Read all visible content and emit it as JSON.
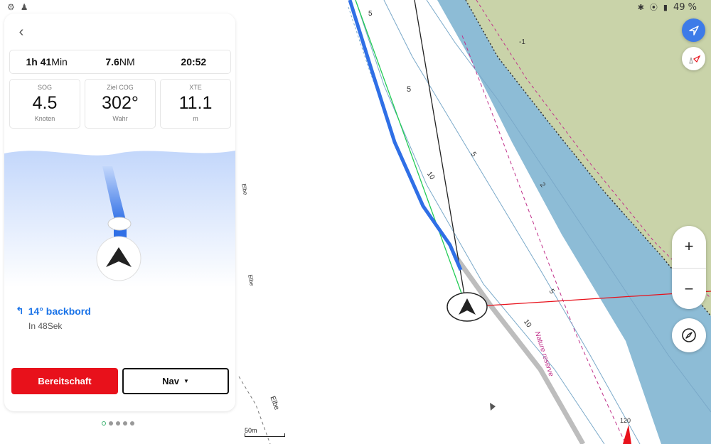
{
  "status_bar": {
    "left_icons": [
      "gear-icon",
      "pawn-icon"
    ],
    "right_icons": [
      "bluetooth-icon",
      "location-pin-icon",
      "battery-icon"
    ],
    "battery": "49 %"
  },
  "panel": {
    "summary": {
      "duration_hours": "1h",
      "duration_minutes": "41",
      "duration_minutes_unit": "Min",
      "distance_value": "7.6",
      "distance_unit": "NM",
      "eta": "20:52"
    },
    "metrics": [
      {
        "label": "SOG",
        "value": "4.5",
        "unit": "Knoten"
      },
      {
        "label": "Ziel COG",
        "value": "302°",
        "unit": "Wahr"
      },
      {
        "label": "XTE",
        "value": "11.1",
        "unit": "m"
      }
    ],
    "instruction": {
      "text": "14° backbord",
      "subtext": "In 48Sek"
    },
    "buttons": {
      "standby": "Bereitschaft",
      "nav": "Nav"
    },
    "pager": {
      "count": 5,
      "active": 0
    }
  },
  "map": {
    "scale_label": "50m",
    "labels": {
      "elbe_1": "Elbe",
      "elbe_2": "Elbe",
      "elbe_3": "Elbe",
      "nature_reserve": "Nature reserve",
      "depth_5a": "5",
      "depth_5b": "5",
      "depth_10a": "10",
      "depth_10b": "10",
      "depth_5c": "5",
      "depth_5d": "5",
      "depth_neg1": "-1",
      "depth_2": "2",
      "bearing_120": "120"
    }
  },
  "colors": {
    "water_deep": "#8dbcd6",
    "land": "#c9d3a9",
    "route_blue": "#2f6fe6",
    "course_green": "#22cc55",
    "red_line": "#e8111b",
    "accent_blue": "#3d7be8",
    "magenta_label": "#c0308a"
  }
}
